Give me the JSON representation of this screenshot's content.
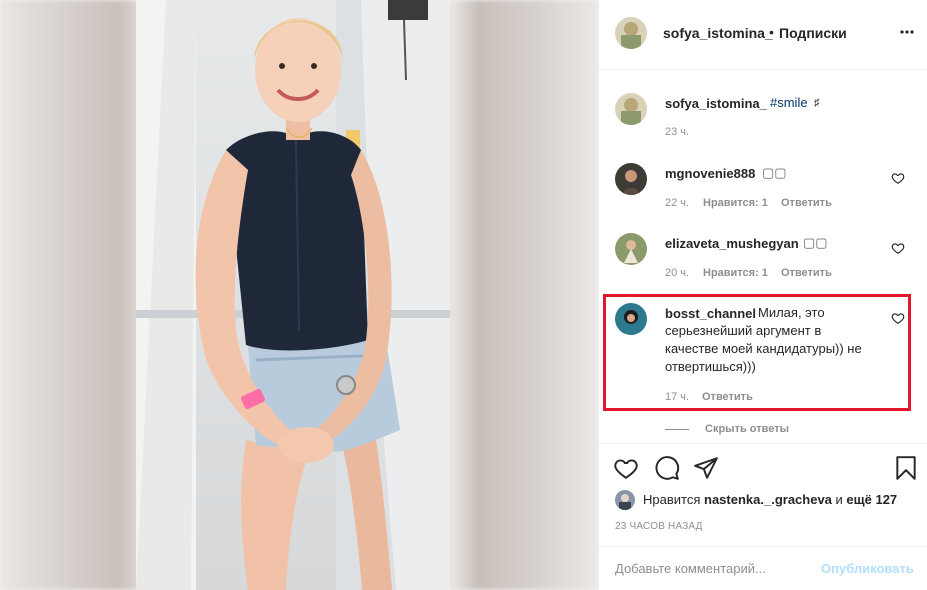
{
  "header": {
    "username": "sofya_istomina_",
    "separator": "•",
    "follow_status": "Подписки"
  },
  "caption": {
    "username": "sofya_istomina_",
    "tag": "#smile",
    "glyph": "♯",
    "time": "23 ч."
  },
  "comments": [
    {
      "username": "mgnovenie888",
      "text": "▢▢",
      "time": "22 ч.",
      "likes": "Нравится: 1",
      "reply": "Ответить"
    },
    {
      "username": "elizaveta_mushegyan",
      "text": "▢▢",
      "time": "20 ч.",
      "likes": "Нравится: 1",
      "reply": "Ответить"
    },
    {
      "username": "bosst_channel",
      "text_lines": [
        "Милая, это",
        "серьезнейший аргумент в",
        "качестве моей кандидатуры)) не",
        "отвертишься)))"
      ],
      "time": "17 ч.",
      "reply": "Ответить"
    }
  ],
  "hide_replies": "Скрыть ответы",
  "likes": {
    "prefix": "Нравится",
    "user": "nastenka._.gracheva",
    "middle": "и",
    "count": "ещё 127"
  },
  "time_ago": "23 ЧАСОВ НАЗАД",
  "add_comment": {
    "placeholder": "Добавьте комментарий...",
    "publish": "Опубликовать"
  },
  "colors": {
    "highlight_border": "#e3162a",
    "link_blue": "#00376b",
    "publish_disabled": "#b2dffc",
    "muted_text": "#8e8e8e"
  }
}
